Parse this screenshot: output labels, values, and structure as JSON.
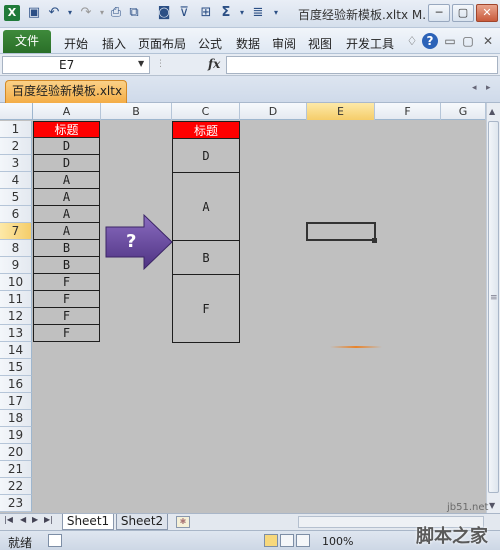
{
  "window": {
    "title": "百度经验新模板.xltx M...",
    "minimize_label": "─",
    "restore_label": "▢",
    "close_label": "✕"
  },
  "quick_access": {
    "icons": [
      "excel-app-icon",
      "save-icon",
      "undo-icon",
      "redo-icon",
      "print-preview-icon",
      "format-painter-icon",
      "camera-icon",
      "filter-icon",
      "border-icon",
      "autosum-icon",
      "align-icon",
      "customize-qat-icon"
    ]
  },
  "ribbon": {
    "file_tab": "文件",
    "tabs": [
      "开始",
      "插入",
      "页面布局",
      "公式",
      "数据",
      "审阅",
      "视图",
      "开发工具"
    ]
  },
  "formula_bar": {
    "name_box_value": "E7",
    "fx_label": "fx",
    "formula_value": ""
  },
  "workbook_tab": "百度经验新模板.xltx",
  "sheet": {
    "columns": [
      "A",
      "B",
      "C",
      "D",
      "E",
      "F",
      "G"
    ],
    "selected_column": "E",
    "rows": [
      "1",
      "2",
      "3",
      "4",
      "5",
      "6",
      "7",
      "8",
      "9",
      "10",
      "11",
      "12",
      "13",
      "14",
      "15",
      "16",
      "17",
      "18",
      "19",
      "20",
      "21",
      "22",
      "23"
    ],
    "selected_row": "7",
    "col_a": {
      "header": "标题",
      "values": [
        "D",
        "D",
        "A",
        "A",
        "A",
        "A",
        "B",
        "B",
        "F",
        "F",
        "F",
        "F"
      ]
    },
    "col_c": {
      "header": "标题",
      "merged_values": [
        "D",
        "A",
        "B",
        "F"
      ]
    },
    "arrow_label": "?"
  },
  "sheet_tabs": [
    "Sheet1",
    "Sheet2"
  ],
  "active_sheet": "Sheet1",
  "status": {
    "ready": "就绪",
    "zoom": "100%"
  },
  "watermark": {
    "url": "jb51.net",
    "text": "脚本之家"
  },
  "colors": {
    "header_fill": "#ff0000",
    "sheet_background": "#c0c0c0",
    "arrow_fill": "#6a4a9c",
    "file_tab": "#2e7b2c",
    "workbook_tab": "#f6b655"
  }
}
